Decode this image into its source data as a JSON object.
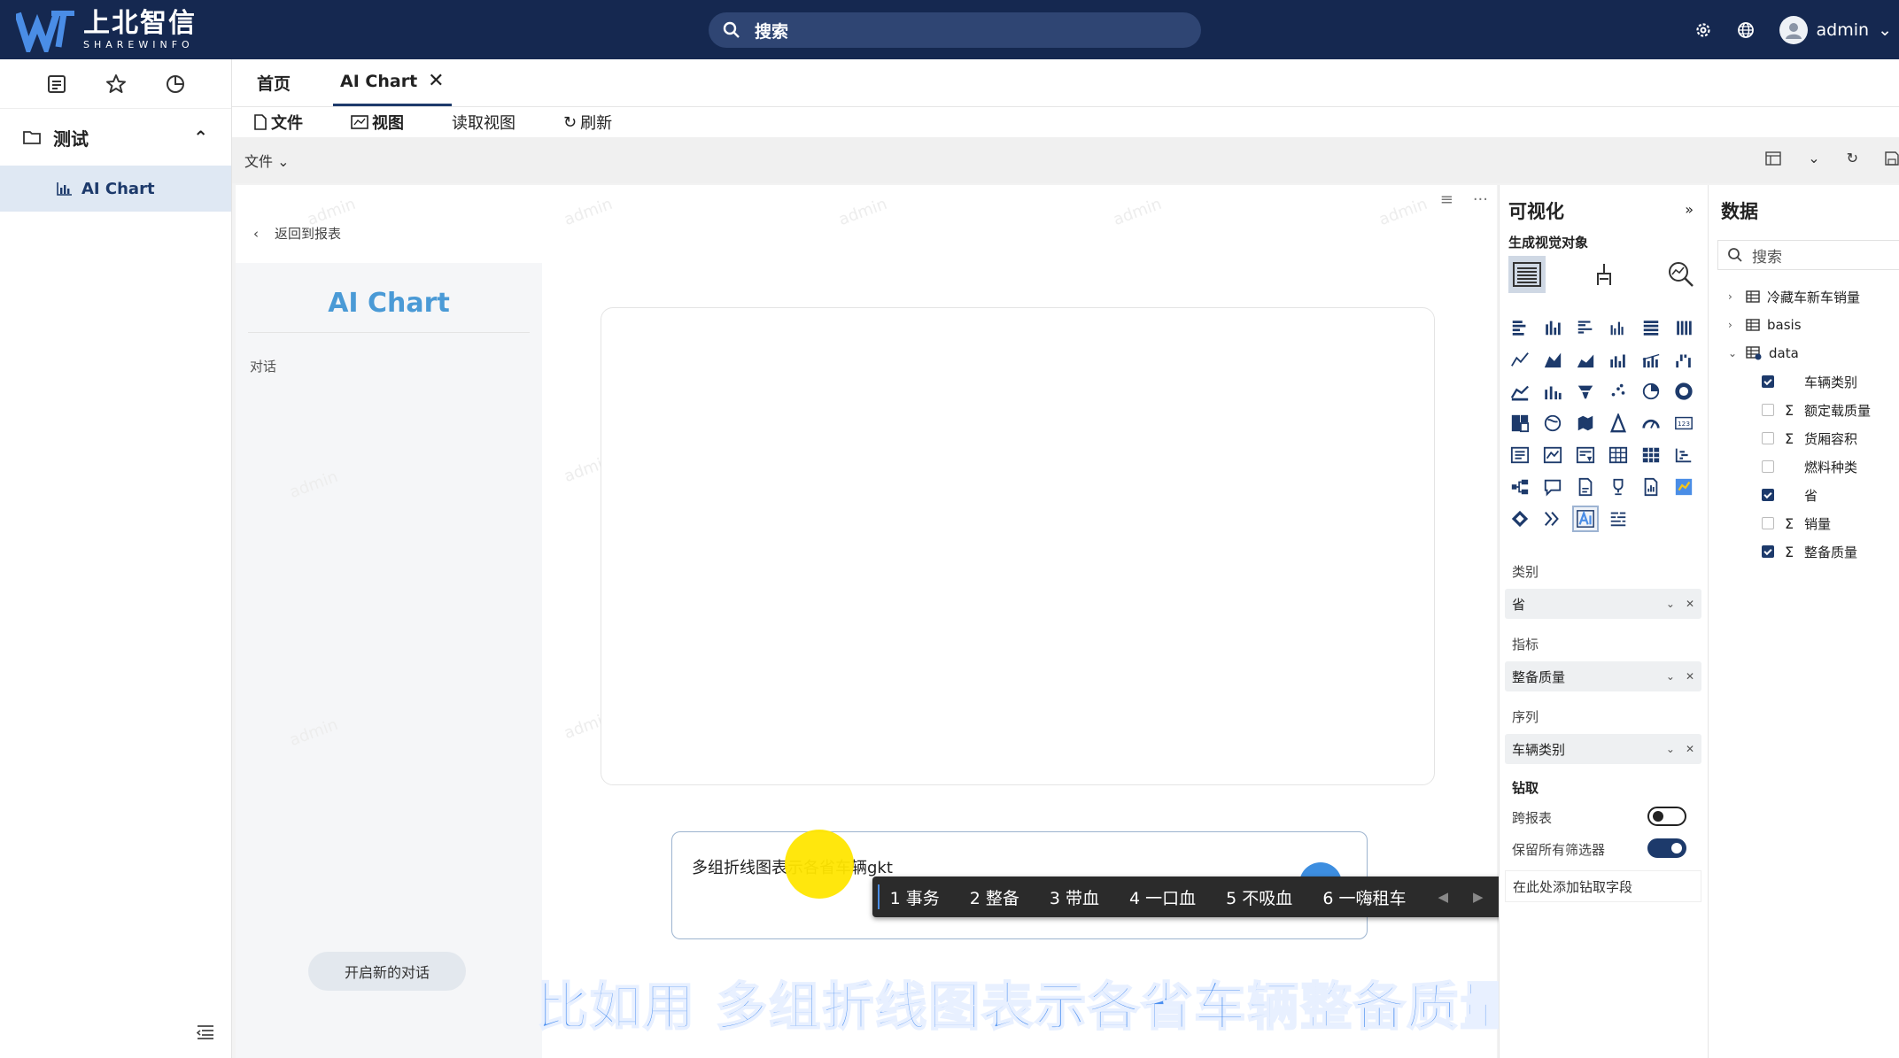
{
  "app": {
    "logo_cn": "上北智信",
    "logo_en": "SHAREWINFO",
    "search_label": "搜索",
    "user": "admin"
  },
  "sidebar": {
    "group": "测试",
    "items": [
      {
        "label": "AI Chart"
      }
    ]
  },
  "tabs": [
    {
      "label": "首页"
    },
    {
      "label": "AI Chart"
    }
  ],
  "toolbar": {
    "file": "文件",
    "view": "视图",
    "read_view": "读取视图",
    "refresh": "刷新"
  },
  "subbar": {
    "file_menu": "文件"
  },
  "report": {
    "back": "返回到报表",
    "watermark": "admin"
  },
  "chat": {
    "title": "AI Chart",
    "conversation_label": "对话",
    "new_chat": "开启新的对话",
    "input_text": "多组折线图表示各省车辆gkt"
  },
  "ime": {
    "candidates": [
      "1 事务",
      "2 整备",
      "3 带血",
      "4 一口血",
      "5 不吸血",
      "6 一嗨租车"
    ]
  },
  "caption": "比如用  多组折线图表示各省车辆整备质量",
  "visualization": {
    "title": "可视化",
    "subtitle": "生成视觉对象",
    "category_label": "类别",
    "category_value": "省",
    "metric_label": "指标",
    "metric_value": "整备质量",
    "series_label": "序列",
    "series_value": "车辆类别",
    "drill_label": "钻取",
    "cross_report_label": "跨报表",
    "cross_report_on": false,
    "keep_filters_label": "保留所有筛选器",
    "keep_filters_on": true,
    "drill_placeholder": "在此处添加钻取字段"
  },
  "data_panel": {
    "title": "数据",
    "search_placeholder": "搜索",
    "tables": [
      {
        "name": "冷藏车新车销量",
        "expanded": false
      },
      {
        "name": "basis",
        "expanded": false
      },
      {
        "name": "data",
        "expanded": true
      }
    ],
    "fields": [
      {
        "name": "车辆类别",
        "checked": true,
        "sigma": false
      },
      {
        "name": "额定载质量",
        "checked": false,
        "sigma": true
      },
      {
        "name": "货厢容积",
        "checked": false,
        "sigma": true
      },
      {
        "name": "燃料种类",
        "checked": false,
        "sigma": false
      },
      {
        "name": "省",
        "checked": true,
        "sigma": false
      },
      {
        "name": "销量",
        "checked": false,
        "sigma": true
      },
      {
        "name": "整备质量",
        "checked": true,
        "sigma": true
      }
    ]
  },
  "colors": {
    "topbar": "#152850",
    "accent": "#1d3a6b",
    "title_blue": "#4a9ad6",
    "caption_blue": "#4b8ff0"
  }
}
